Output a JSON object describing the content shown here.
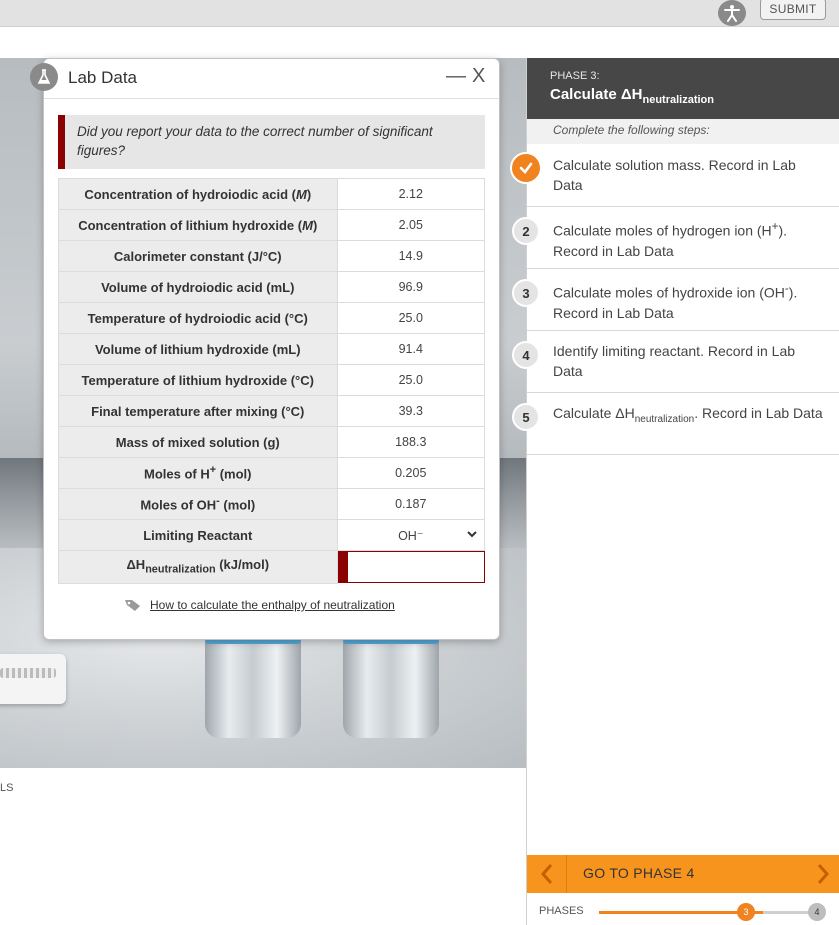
{
  "topbar": {
    "submit_label": "SUBMIT"
  },
  "lab": {
    "title": "Lab Data",
    "minimize_label": "—",
    "close_label": "X",
    "sigfig_prompt": "Did you report your data to the correct number of significant figures?",
    "rows": [
      {
        "label_parts": [
          "Concentration of hydroiodic acid (",
          "M",
          ")"
        ],
        "value": "2.12"
      },
      {
        "label_parts": [
          "Concentration of lithium hydroxide (",
          "M",
          ")"
        ],
        "value": "2.05"
      },
      {
        "label": "Calorimeter constant (J/°C)",
        "value": "14.9"
      },
      {
        "label": "Volume of hydroiodic acid (mL)",
        "value": "96.9"
      },
      {
        "label": "Temperature of hydroiodic acid (°C)",
        "value": "25.0"
      },
      {
        "label": "Volume of lithium hydroxide (mL)",
        "value": "91.4"
      },
      {
        "label": "Temperature of lithium hydroxide (°C)",
        "value": "25.0"
      },
      {
        "label": "Final temperature after mixing (°C)",
        "value": "39.3"
      },
      {
        "label": "Mass of mixed solution (g)",
        "value": "188.3"
      },
      {
        "label_parts": [
          "Moles of H",
          "+",
          " (mol)"
        ],
        "value": "0.205"
      },
      {
        "label_parts": [
          "Moles of OH",
          "-",
          " (mol)"
        ],
        "value": "0.187"
      },
      {
        "label": "Limiting Reactant",
        "value": "OH⁻"
      },
      {
        "label_parts": [
          "ΔH",
          "neutralization",
          " (kJ/mol)"
        ],
        "value": ""
      }
    ],
    "help_link": "How to calculate the enthalpy of neutralization"
  },
  "panel": {
    "phase_label": "PHASE 3:",
    "phase_title_parts": [
      "Calculate ΔH",
      "neutralization"
    ],
    "steps_intro": "Complete the following steps:",
    "steps": [
      {
        "num": "",
        "text": "Calculate solution mass. Record in Lab Data",
        "done": true
      },
      {
        "num": "2",
        "text_parts": [
          "Calculate moles of hydrogen ion (H",
          "+",
          "). Record in Lab Data"
        ]
      },
      {
        "num": "3",
        "text_parts": [
          "Calculate moles of hydroxide ion (OH",
          "-",
          "). Record in Lab Data"
        ]
      },
      {
        "num": "4",
        "text": "Identify limiting reactant. Record in Lab Data"
      },
      {
        "num": "5",
        "text_parts": [
          "Calculate ΔH",
          "neutralization",
          ". Record in Lab Data"
        ]
      }
    ],
    "nav_label": "GO TO PHASE 4",
    "phases_label": "PHASES",
    "current_phase": "3",
    "next_phase": "4",
    "phase_progress_fraction": 0.75
  },
  "scene": {
    "left_label": "LS"
  },
  "colors": {
    "accent": "#f0831f",
    "nav_orange": "#f7941d",
    "alert_red": "#8b0000",
    "header_dark": "#474747"
  }
}
